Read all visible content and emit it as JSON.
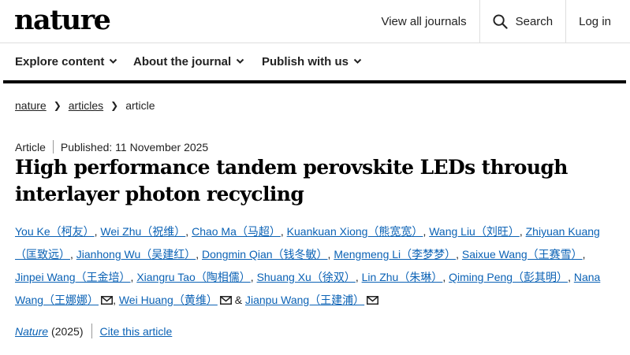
{
  "header": {
    "logo": "nature",
    "view_all": "View all journals",
    "search": "Search",
    "login": "Log in"
  },
  "nav": {
    "explore": "Explore content",
    "about": "About the journal",
    "publish": "Publish with us"
  },
  "breadcrumb": [
    "nature",
    "articles",
    "article"
  ],
  "article": {
    "type": "Article",
    "published": "Published: 11 November 2025",
    "title": "High performance tandem perovskite LEDs through interlayer photon recycling",
    "authors": [
      "You Ke（柯友）",
      "Wei Zhu（祝维）",
      "Chao Ma（马超）",
      "Kuankuan Xiong（熊宽宽）",
      "Wang Liu（刘旺）",
      "Zhiyuan Kuang（匡致远）",
      "Jianhong Wu（吴建红）",
      "Dongmin Qian（钱冬敏）",
      "Mengmeng Li（李梦梦）",
      "Saixue Wang（王赛雪）",
      "Jinpei Wang（王金培）",
      "Xiangru Tao（陶相儒）",
      "Shuang Xu（徐双）",
      "Lin Zhu（朱琳）",
      "Qiming Peng（彭其明）",
      "Nana Wang（王娜娜）",
      "Wei Huang（黄维）",
      "Jianpu Wang（王建浦）"
    ],
    "amp": "&",
    "journal": "Nature",
    "year": "(2025)",
    "cite": "Cite this article"
  },
  "icons": {
    "search": "search-icon",
    "chevron": "chevron-down-icon",
    "mail": "mail-icon"
  },
  "colors": {
    "link": "#0b62b5",
    "rule": "#000000"
  }
}
